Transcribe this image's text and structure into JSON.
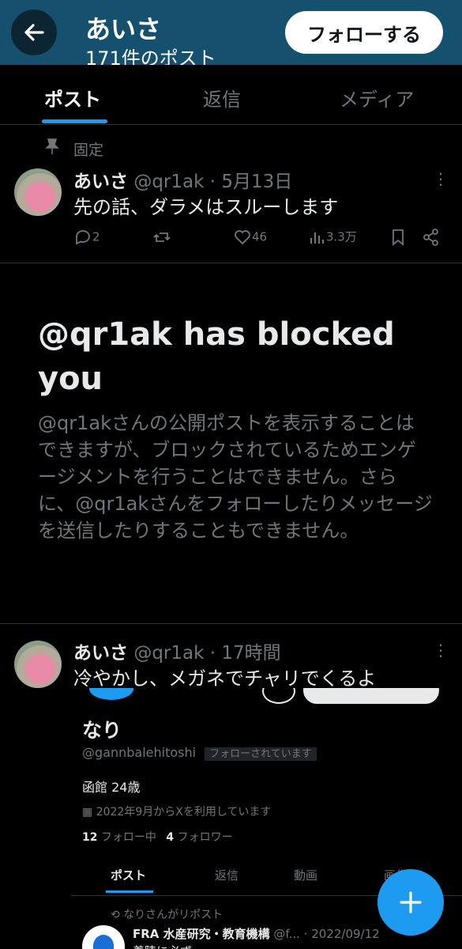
{
  "header": {
    "name": "あいさ",
    "post_count": "171件のポスト",
    "follow_label": "フォローする"
  },
  "tabs": [
    {
      "label": "ポスト",
      "active": true
    },
    {
      "label": "返信",
      "active": false
    },
    {
      "label": "メディア",
      "active": false
    }
  ],
  "pinned": {
    "label": "固定",
    "author": "あいさ",
    "handle": "@qr1ak",
    "sep": "·",
    "date": "5月13日",
    "text": "先の話、ダラメはスルーします",
    "replies": "2",
    "likes": "46",
    "views": "3.3万"
  },
  "blocked": {
    "title": "@qr1ak has blocked you",
    "body": "@qr1akさんの公開ポストを表示することはできますが、ブロックされているためエンゲージメントを行うことはできません。さらに、@qr1akさんをフォローしたりメッセージを送信したりすることもできません。"
  },
  "post2": {
    "author": "あいさ",
    "handle": "@qr1ak",
    "sep": "·",
    "time": "17時間",
    "text": "冷やかし、メガネでチャリでくるよ"
  },
  "embedded": {
    "name": "なり",
    "handle": "@gannbalehitoshi",
    "follows_you": "フォローされています",
    "bio": "函館 24歳",
    "joined": "2022年9月からXを利用しています",
    "following_count": "12",
    "following_label": "フォロー中",
    "followers_count": "4",
    "followers_label": "フォロワー",
    "tabs": [
      "ポスト",
      "返信",
      "動画",
      "画像"
    ],
    "repost_label": "なりさんがリポスト",
    "repost_author": "FRA 水産研究・教育機構",
    "repost_handle": "@f...",
    "repost_date": "· 2022/09/12",
    "repost_text": "着陸に必ず…"
  },
  "colors": {
    "header_bg": "#15506e",
    "accent": "#1d9bf0",
    "text_primary": "#e7e9ea",
    "text_secondary": "#71767b"
  }
}
